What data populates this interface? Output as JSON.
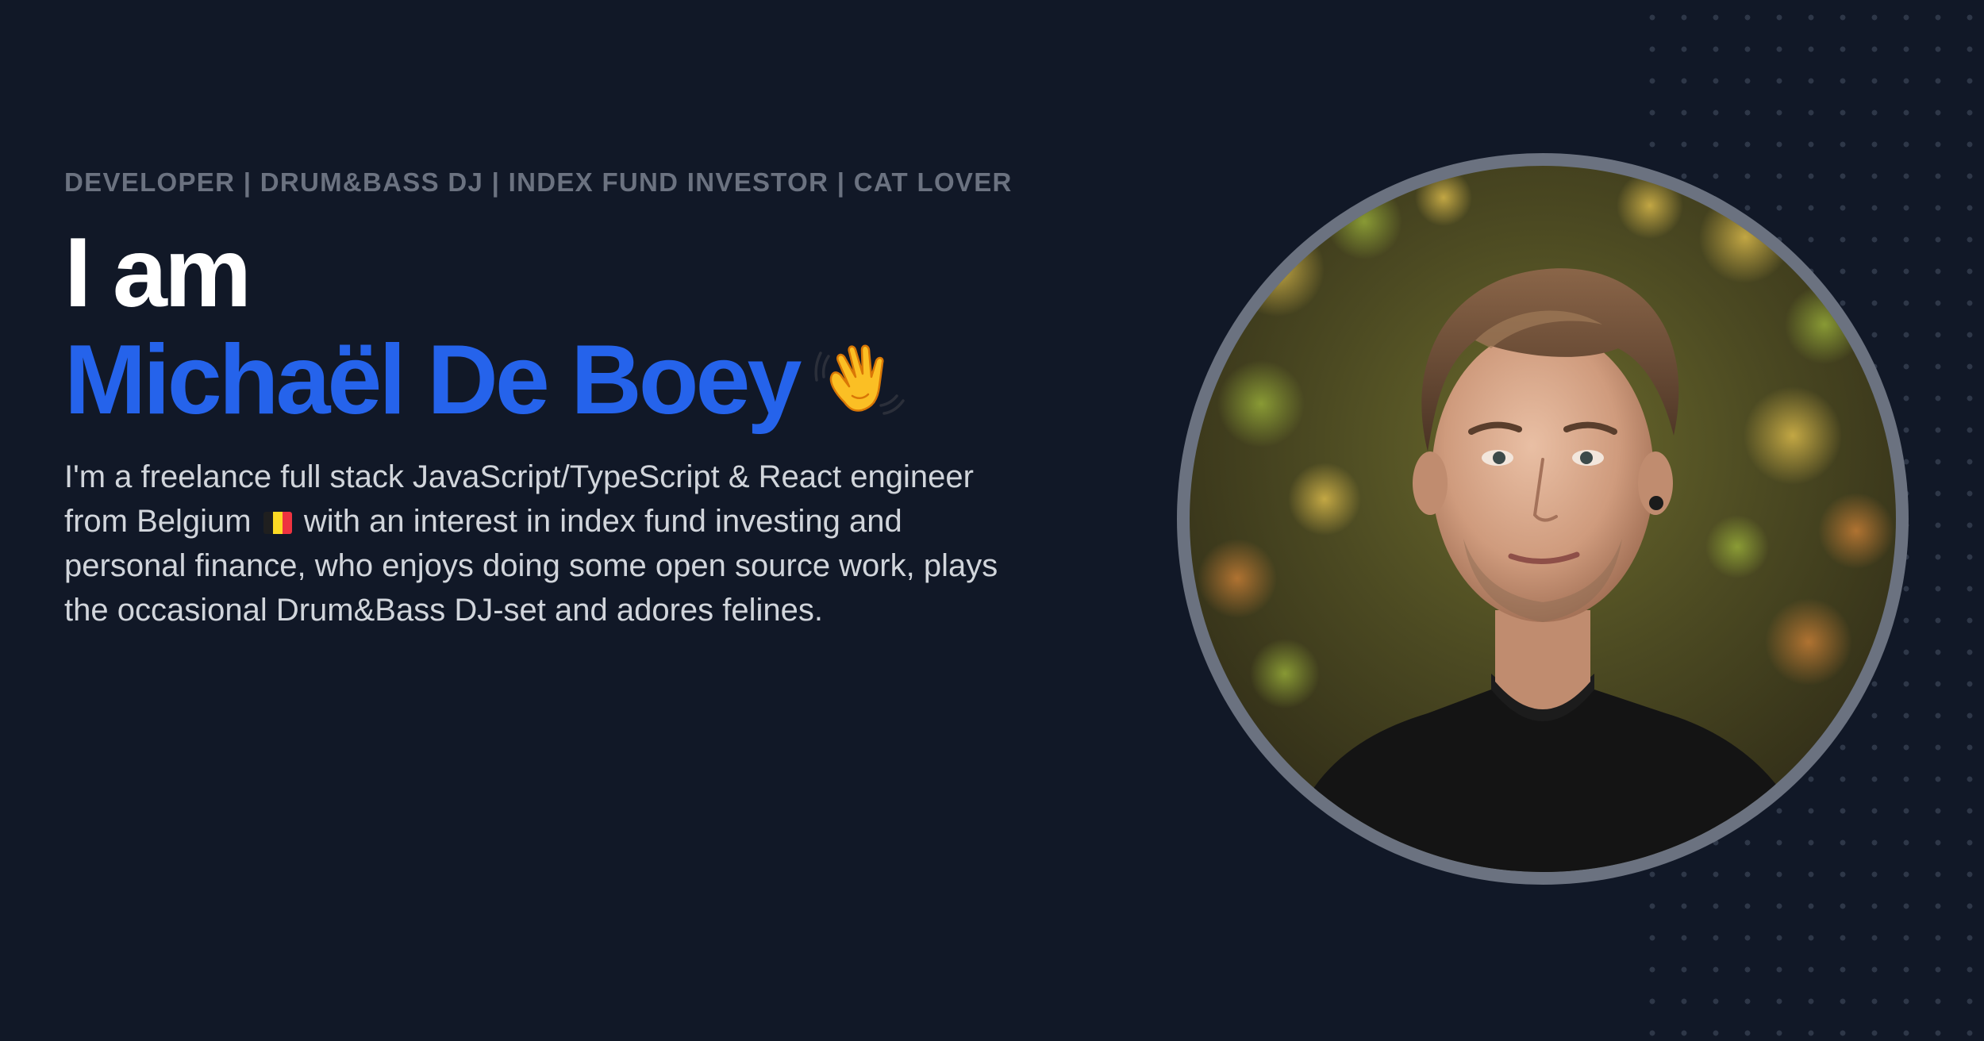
{
  "hero": {
    "tagline": "DEVELOPER | DRUM&BASS DJ | INDEX FUND INVESTOR | CAT LOVER",
    "intro": "I am",
    "name": "Michaël De Boey",
    "wave_icon": "waving-hand-icon",
    "bio_part1": "I'm a freelance full stack JavaScript/TypeScript & React engineer from Belgium",
    "flag_icon": "belgium-flag-icon",
    "bio_part2": "with an interest in index fund investing and personal finance, who enjoys doing some open source work, plays the occasional Drum&Bass DJ-set and adores felines."
  },
  "avatar": {
    "icon": "profile-photo"
  },
  "colors": {
    "background": "#111827",
    "accent": "#2563eb",
    "tagline": "#6b7280",
    "body_text": "#d1d5db",
    "ring": "#6b7280",
    "dots": "#2e3748"
  }
}
